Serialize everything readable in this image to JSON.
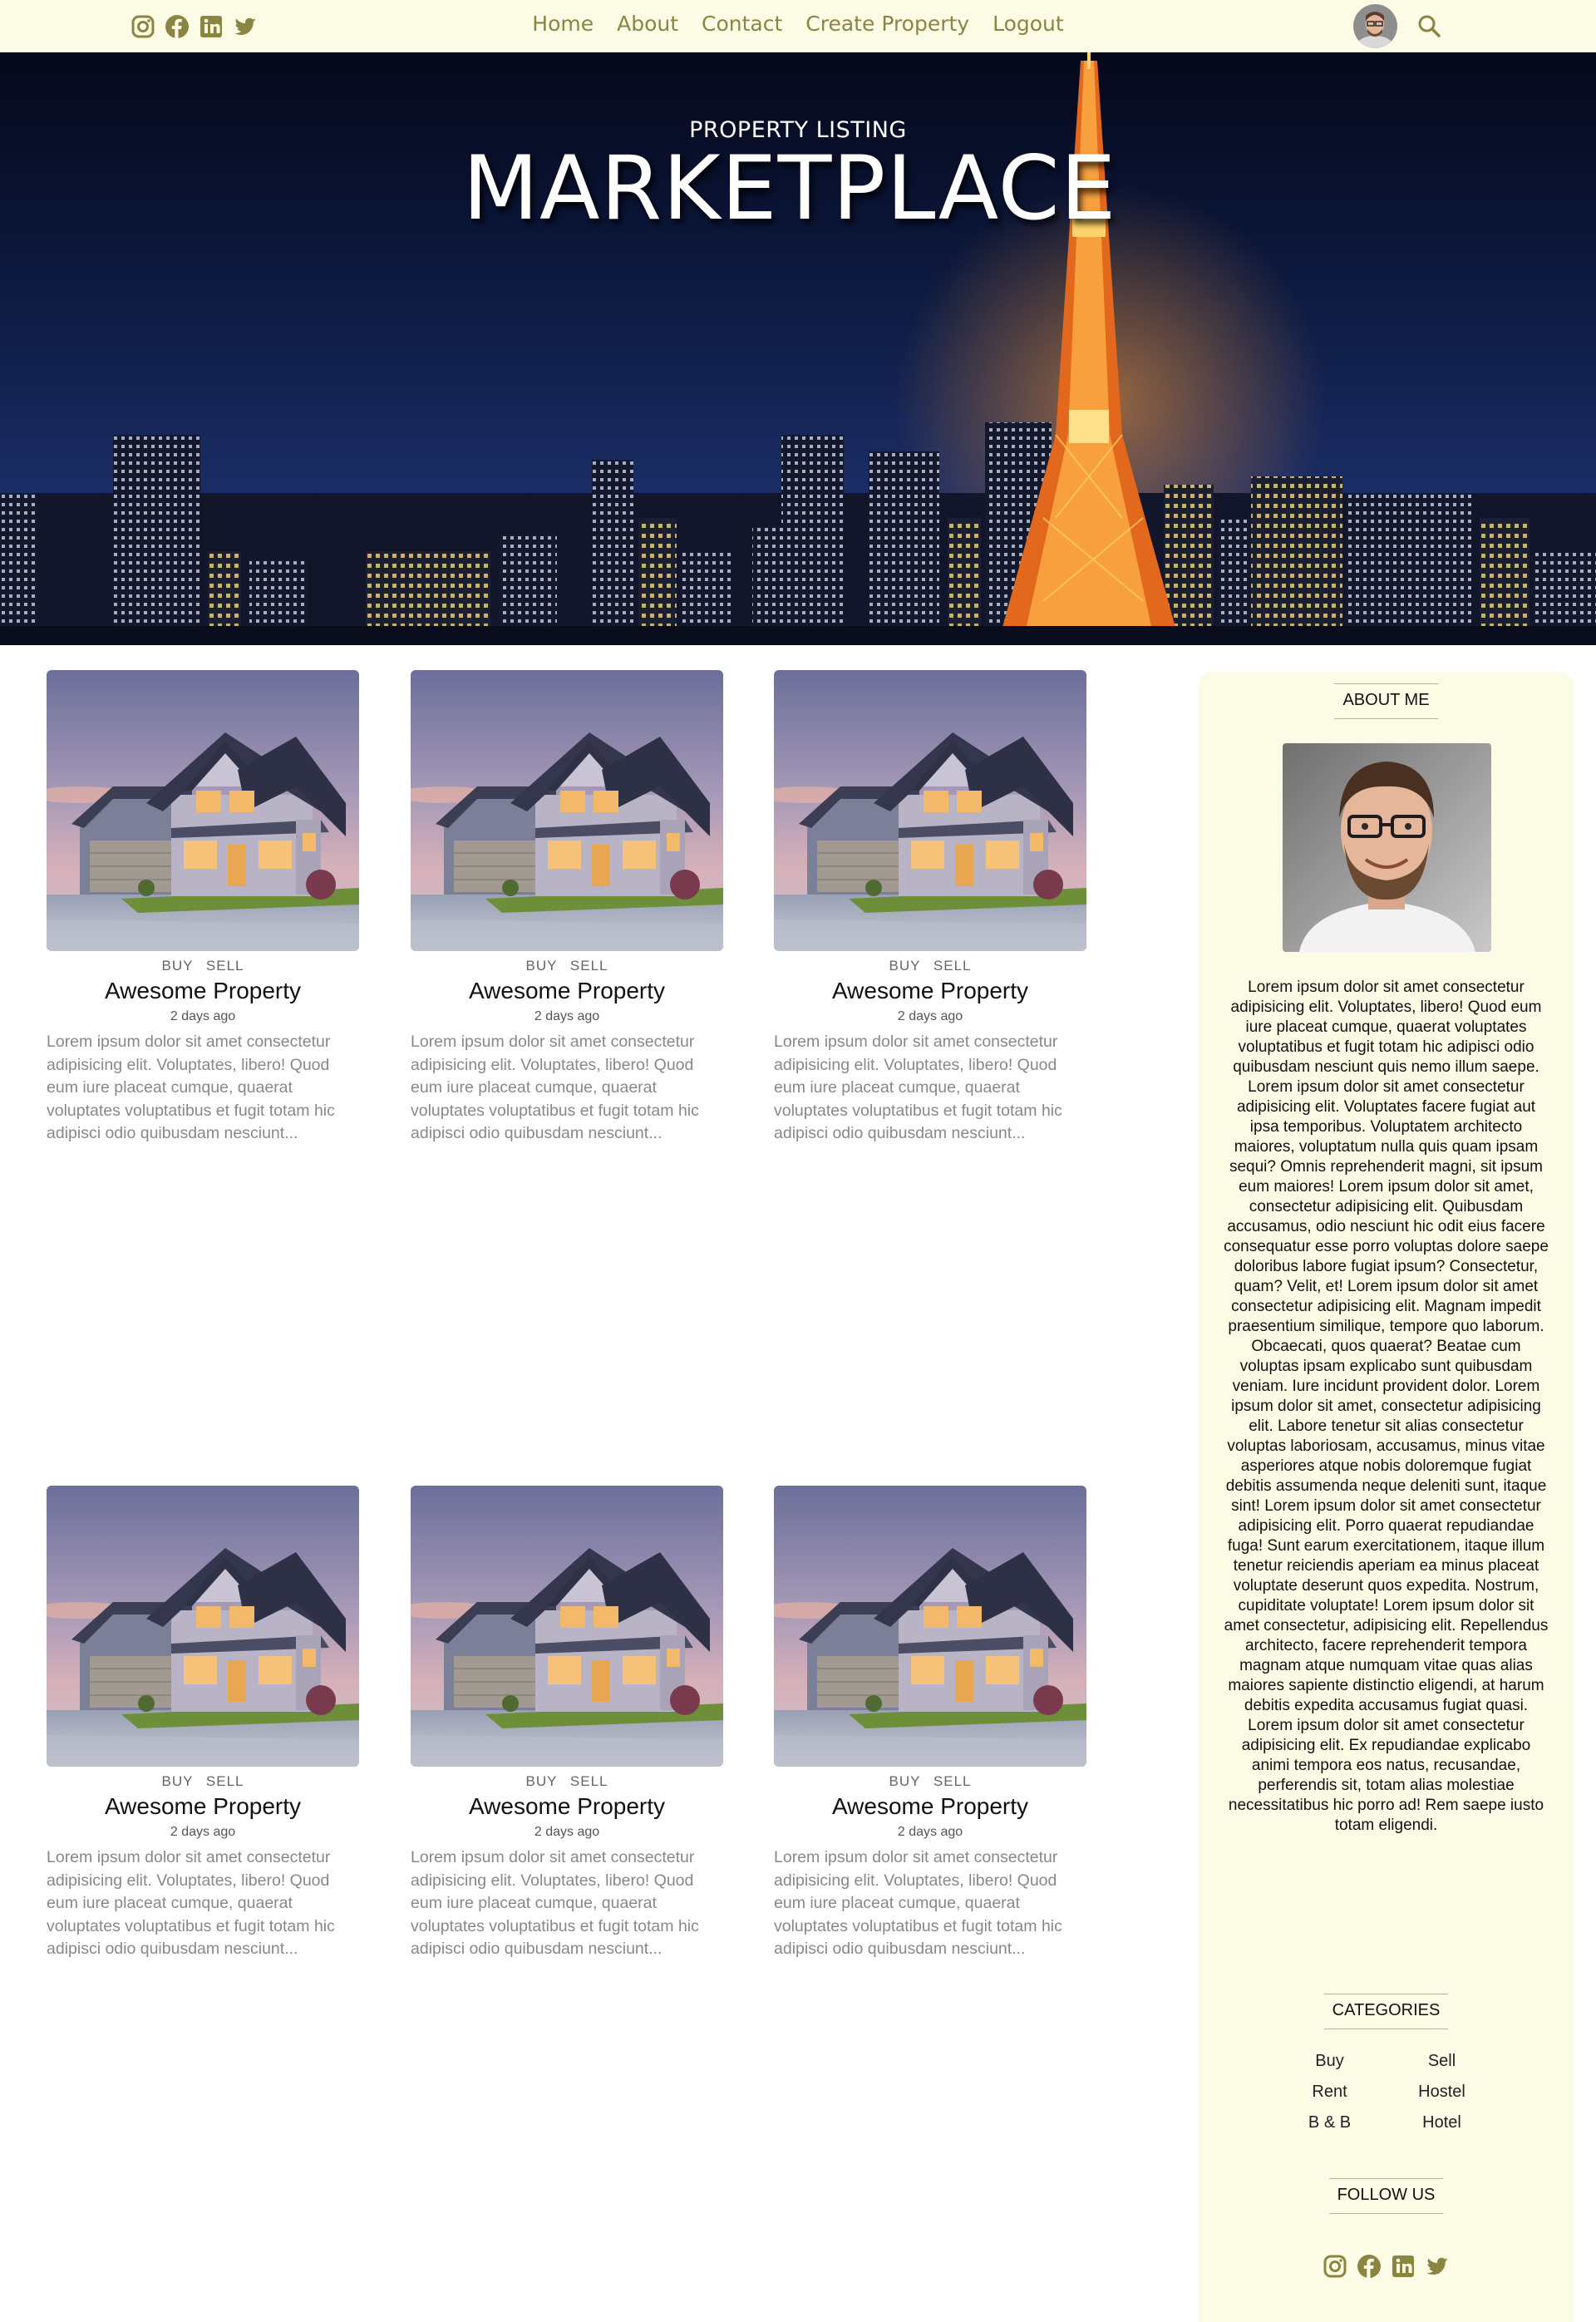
{
  "nav": {
    "social_icons": [
      "instagram-icon",
      "facebook-icon",
      "linkedin-icon",
      "twitter-icon"
    ],
    "links": [
      "Home",
      "About",
      "Contact",
      "Create Property",
      "Logout"
    ],
    "accent_color": "#8a8540"
  },
  "hero": {
    "subtitle": "PROPERTY LISTING",
    "title": "MARKETPLACE"
  },
  "properties": [
    {
      "tag_buy": "BUY",
      "tag_sell": "SELL",
      "title": "Awesome Property",
      "date": "2 days ago",
      "description": "Lorem ipsum dolor sit amet consectetur adipisicing elit. Voluptates, libero! Quod eum iure placeat cumque, quaerat voluptates voluptatibus et fugit totam hic adipisci odio quibusdam nesciunt..."
    },
    {
      "tag_buy": "BUY",
      "tag_sell": "SELL",
      "title": "Awesome Property",
      "date": "2 days ago",
      "description": "Lorem ipsum dolor sit amet consectetur adipisicing elit. Voluptates, libero! Quod eum iure placeat cumque, quaerat voluptates voluptatibus et fugit totam hic adipisci odio quibusdam nesciunt..."
    },
    {
      "tag_buy": "BUY",
      "tag_sell": "SELL",
      "title": "Awesome Property",
      "date": "2 days ago",
      "description": "Lorem ipsum dolor sit amet consectetur adipisicing elit. Voluptates, libero! Quod eum iure placeat cumque, quaerat voluptates voluptatibus et fugit totam hic adipisci odio quibusdam nesciunt..."
    },
    {
      "tag_buy": "BUY",
      "tag_sell": "SELL",
      "title": "Awesome Property",
      "date": "2 days ago",
      "description": "Lorem ipsum dolor sit amet consectetur adipisicing elit. Voluptates, libero! Quod eum iure placeat cumque, quaerat voluptates voluptatibus et fugit totam hic adipisci odio quibusdam nesciunt..."
    },
    {
      "tag_buy": "BUY",
      "tag_sell": "SELL",
      "title": "Awesome Property",
      "date": "2 days ago",
      "description": "Lorem ipsum dolor sit amet consectetur adipisicing elit. Voluptates, libero! Quod eum iure placeat cumque, quaerat voluptates voluptatibus et fugit totam hic adipisci odio quibusdam nesciunt..."
    },
    {
      "tag_buy": "BUY",
      "tag_sell": "SELL",
      "title": "Awesome Property",
      "date": "2 days ago",
      "description": "Lorem ipsum dolor sit amet consectetur adipisicing elit. Voluptates, libero! Quod eum iure placeat cumque, quaerat voluptates voluptatibus et fugit totam hic adipisci odio quibusdam nesciunt..."
    }
  ],
  "sidebar": {
    "background_color": "#fcfce6",
    "about_heading": "ABOUT ME",
    "about_text": "Lorem ipsum dolor sit amet consectetur adipisicing elit. Voluptates, libero! Quod eum iure placeat cumque, quaerat voluptates voluptatibus et fugit totam hic adipisci odio quibusdam nesciunt quis nemo illum saepe. Lorem ipsum dolor sit amet consectetur adipisicing elit. Voluptates facere fugiat aut ipsa temporibus. Voluptatem architecto maiores, voluptatum nulla quis quam ipsam sequi? Omnis reprehenderit magni, sit ipsum eum maiores! Lorem ipsum dolor sit amet, consectetur adipisicing elit. Quibusdam accusamus, odio nesciunt hic odit eius facere consequatur esse porro voluptas dolore saepe doloribus labore fugiat ipsum? Consectetur, quam? Velit, et! Lorem ipsum dolor sit amet consectetur adipisicing elit. Magnam impedit praesentium similique, tempore quo laborum. Obcaecati, quos quaerat? Beatae cum voluptas ipsam explicabo sunt quibusdam veniam. Iure incidunt provident dolor. Lorem ipsum dolor sit amet, consectetur adipisicing elit. Labore tenetur sit alias consectetur voluptas laboriosam, accusamus, minus vitae asperiores atque nobis doloremque fugiat debitis assumenda neque deleniti sunt, itaque sint! Lorem ipsum dolor sit amet consectetur adipisicing elit. Porro quaerat repudiandae fuga! Sunt earum exercitationem, itaque illum tenetur reiciendis aperiam ea minus placeat voluptate deserunt quos expedita. Nostrum, cupiditate voluptate! Lorem ipsum dolor sit amet consectetur, adipisicing elit. Repellendus architecto, facere reprehenderit tempora magnam atque numquam vitae quas alias maiores sapiente distinctio eligendi, at harum debitis expedita accusamus fugiat quasi. Lorem ipsum dolor sit amet consectetur adipisicing elit. Ex repudiandae explicabo animi tempora eos natus, recusandae, perferendis sit, totam alias molestiae necessitatibus hic porro ad! Rem saepe iusto totam eligendi.",
    "categories_heading": "CATEGORIES",
    "categories": [
      "Buy",
      "Sell",
      "Rent",
      "Hostel",
      "B & B",
      "Hotel"
    ],
    "follow_heading": "FOLLOW US",
    "social_icons": [
      "instagram-icon",
      "facebook-icon",
      "linkedin-icon",
      "twitter-icon"
    ]
  }
}
